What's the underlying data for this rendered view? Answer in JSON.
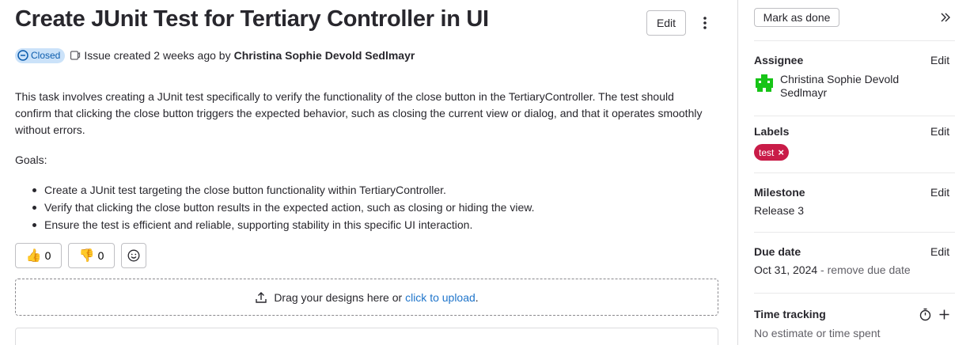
{
  "issue": {
    "title": "Create JUnit Test for Tertiary Controller in UI",
    "edit_label": "Edit",
    "status": "Closed",
    "created_text": "Issue created 2 weeks ago by",
    "author": "Christina Sophie Devold Sedlmayr",
    "description": "This task involves creating a JUnit test specifically to verify the functionality of the close button in the TertiaryController. The test should confirm that clicking the close button triggers the expected behavior, such as closing the current view or dialog, and that it operates smoothly without errors.",
    "goals_label": "Goals:",
    "goals": [
      "Create a JUnit test targeting the close button functionality within TertiaryController.",
      "Verify that clicking the close button results in the expected action, such as closing or hiding the view.",
      "Ensure the test is efficient and reliable, supporting stability in this specific UI interaction."
    ],
    "reactions": {
      "thumbs_up_icon": "👍",
      "thumbs_up_count": "0",
      "thumbs_down_icon": "👎",
      "thumbs_down_count": "0"
    },
    "upload": {
      "text": "Drag your designs here or",
      "link": "click to upload",
      "suffix": "."
    }
  },
  "sidebar": {
    "mark_done": "Mark as done",
    "assignee": {
      "title": "Assignee",
      "edit": "Edit",
      "name": "Christina Sophie Devold Sedlmayr"
    },
    "labels": {
      "title": "Labels",
      "edit": "Edit",
      "label": "test",
      "remove": "×"
    },
    "milestone": {
      "title": "Milestone",
      "edit": "Edit",
      "value": "Release 3"
    },
    "due_date": {
      "title": "Due date",
      "edit": "Edit",
      "value": "Oct 31, 2024",
      "separator": " - ",
      "remove": "remove due date"
    },
    "time_tracking": {
      "title": "Time tracking",
      "value": "No estimate or time spent"
    }
  },
  "colors": {
    "label_bg": "#c91c48",
    "status_bg": "#cbe2f9",
    "status_fg": "#0b5cad",
    "link": "#1f75cb",
    "avatar": "#17c417"
  }
}
